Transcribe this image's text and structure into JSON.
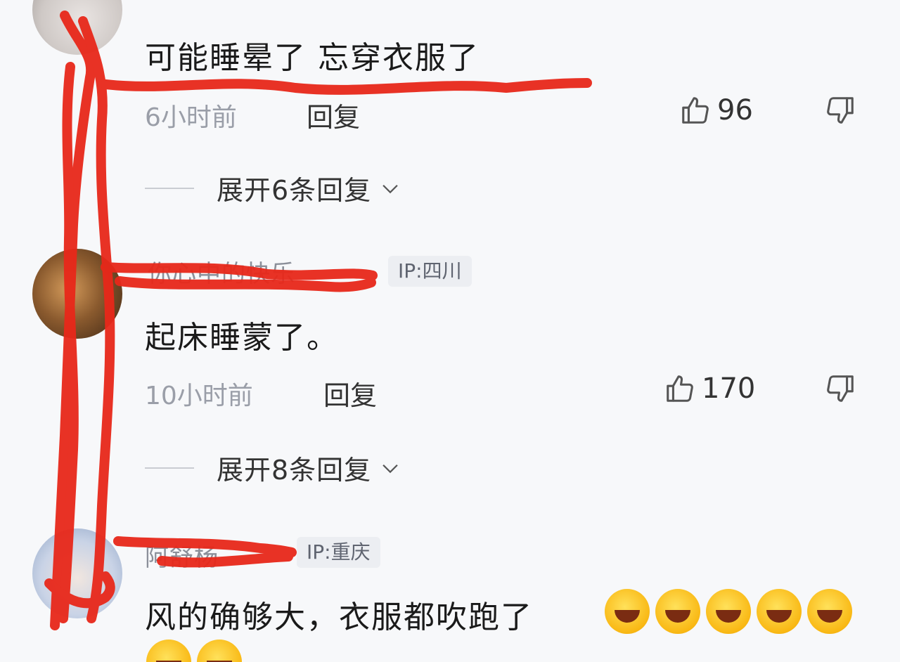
{
  "comments": [
    {
      "text": "可能睡晕了 忘穿衣服了",
      "time": "6小时前",
      "reply_label": "回复",
      "likes": "96",
      "expand_label": "展开6条回复"
    },
    {
      "username": "你心中的快乐",
      "ip": "IP:四川",
      "text": "起床睡蒙了。",
      "time": "10小时前",
      "reply_label": "回复",
      "likes": "170",
      "expand_label": "展开8条回复"
    },
    {
      "username": "阿舒杨",
      "ip": "IP:重庆",
      "text": "风的确够大，衣服都吹跑了"
    }
  ],
  "colors": {
    "scribble": "#e8281a",
    "meta_text": "#9a9ea8",
    "badge_bg": "#eceef2"
  },
  "icons": [
    "thumb-up-icon",
    "thumb-down-icon",
    "chevron-down-icon",
    "laughing-emoji"
  ]
}
